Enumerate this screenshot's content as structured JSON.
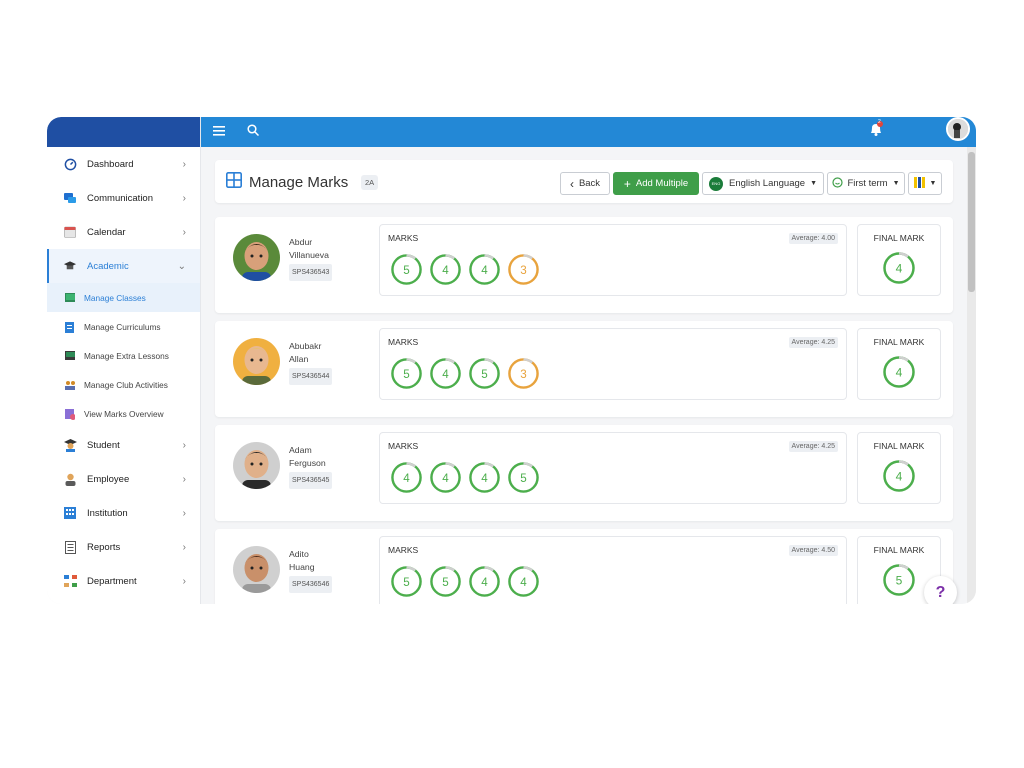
{
  "sidebar": {
    "items": [
      {
        "label": "Dashboard",
        "icon": "gauge-icon",
        "color": "#2388d6"
      },
      {
        "label": "Communication",
        "icon": "chat-icon",
        "color": "#2388d6"
      },
      {
        "label": "Calendar",
        "icon": "calendar-icon",
        "color": "#d9534f"
      },
      {
        "label": "Academic",
        "icon": "graduation-cap-icon",
        "color": "#333333"
      }
    ],
    "sub_items": [
      {
        "label": "Manage Classes",
        "icon": "classroom-icon"
      },
      {
        "label": "Manage Curriculums",
        "icon": "document-icon"
      },
      {
        "label": "Manage Extra Lessons",
        "icon": "board-icon"
      },
      {
        "label": "Manage Club Activities",
        "icon": "group-icon"
      },
      {
        "label": "View Marks Overview",
        "icon": "report-icon"
      }
    ],
    "items_after": [
      {
        "label": "Student",
        "icon": "student-icon"
      },
      {
        "label": "Employee",
        "icon": "employee-icon"
      },
      {
        "label": "Institution",
        "icon": "building-icon"
      },
      {
        "label": "Reports",
        "icon": "report-list-icon"
      },
      {
        "label": "Department",
        "icon": "org-chart-icon"
      }
    ]
  },
  "topbar": {
    "menu_icon": "hamburger-icon",
    "search_icon": "search-icon",
    "notification_count": "2"
  },
  "header": {
    "title": "Manage Marks",
    "class_badge": "2A",
    "back_label": "Back",
    "add_multiple_label": "Add Multiple",
    "language_badge": "ENG",
    "language_label": "English Language",
    "term_label": "First term"
  },
  "labels": {
    "marks": "MARKS",
    "final_mark": "FINAL MARK"
  },
  "students": [
    {
      "first": "Abdur",
      "last": "Villanueva",
      "id": "SPS436543",
      "average": "Average: 4.00",
      "marks": [
        5,
        4,
        4,
        3
      ],
      "final": 4
    },
    {
      "first": "Abubakr",
      "last": "Allan",
      "id": "SPS436544",
      "average": "Average: 4.25",
      "marks": [
        5,
        4,
        5,
        3
      ],
      "final": 4
    },
    {
      "first": "Adam",
      "last": "Ferguson",
      "id": "SPS436545",
      "average": "Average: 4.25",
      "marks": [
        4,
        4,
        4,
        5
      ],
      "final": 4
    },
    {
      "first": "Adito",
      "last": "Huang",
      "id": "SPS436546",
      "average": "Average: 4.50",
      "marks": [
        5,
        5,
        4,
        4
      ],
      "final": 5
    }
  ],
  "help_label": "?",
  "colors": {
    "topbar": "#2388d6",
    "brand": "#1f4fa3",
    "accent": "#2b7fd6",
    "success": "#3f9e49",
    "mark_green": "#4cae4c",
    "mark_orange": "#e8a33d"
  }
}
